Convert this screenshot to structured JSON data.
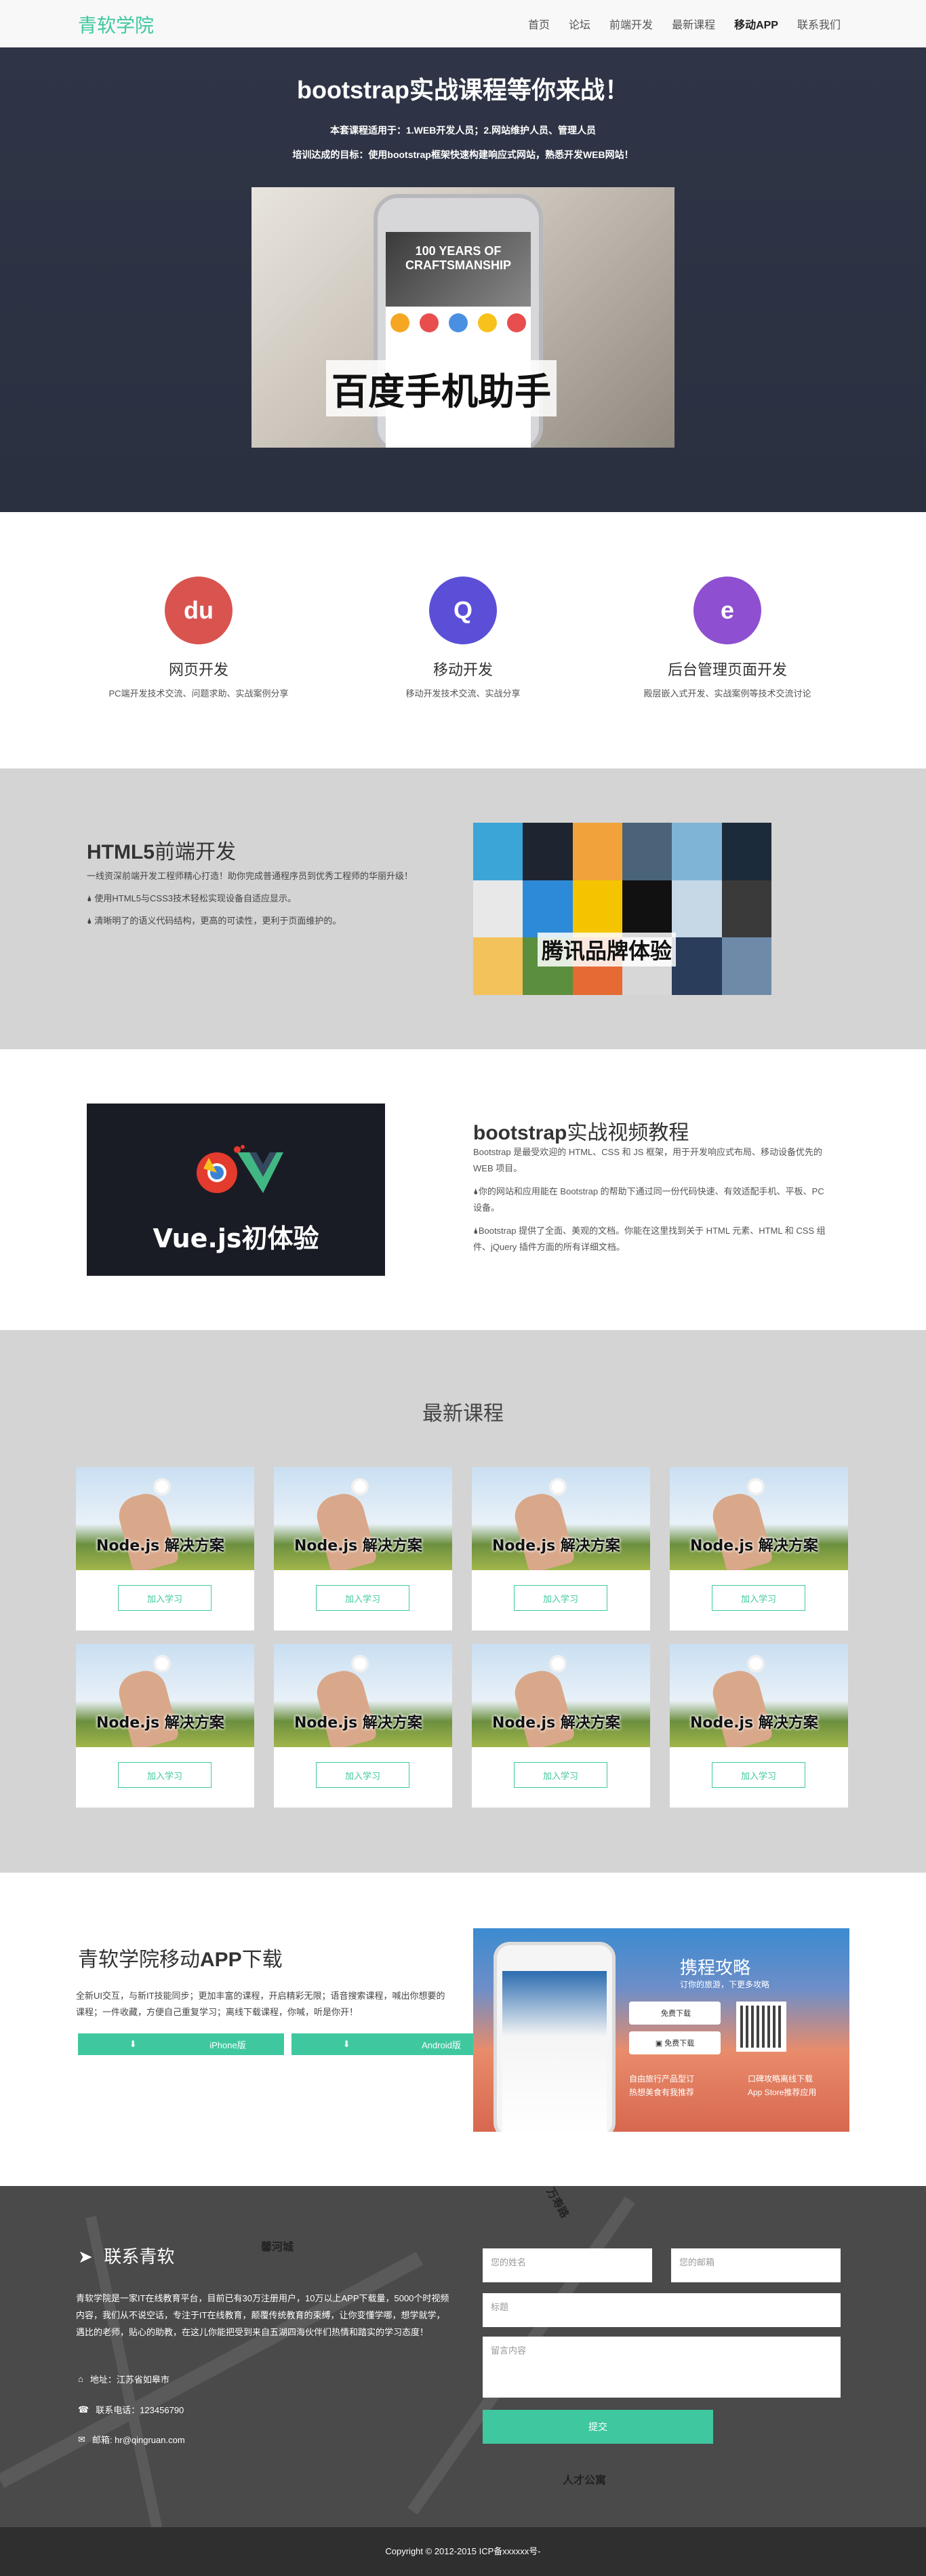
{
  "nav": {
    "brand": "青软学院",
    "items": [
      "首页",
      "论坛",
      "前端开发",
      "最新课程",
      "移动APP",
      "联系我们"
    ]
  },
  "hero": {
    "title": "bootstrap实战课程等你来战！",
    "sub1": "本套课程适用于：1.WEB开发人员；2.网站维护人员、管理人员",
    "sub2": "培训达成的目标：使用bootstrap框架快速构建响应式网站，熟悉开发WEB网站！",
    "image_caption": "百度手机助手",
    "phone_banner": "100 YEARS OF CRAFTSMANSHIP"
  },
  "features": [
    {
      "title": "网页开发",
      "desc": "PC端开发技术交流、问题求助、实战案例分享",
      "icon": "baidu-paw-icon",
      "color": "#d9534f",
      "glyph": "du"
    },
    {
      "title": "移动开发",
      "desc": "移动开发技术交流、实战分享",
      "icon": "qq-penguin-icon",
      "color": "#5b4fd8",
      "glyph": "Q"
    },
    {
      "title": "后台管理页面开发",
      "desc": "殿层嵌入式开发、实战案例等技术交流讨论",
      "icon": "alibaba-icon",
      "color": "#8e4fd0",
      "glyph": "e"
    }
  ],
  "html5": {
    "title_bold": "HTML5",
    "title_rest": "前端开发",
    "line1": "一线资深前端开发工程师精心打造！助你完成普通程序员到优秀工程师的华丽升级！",
    "line2": "使用HTML5与CSS3技术轻松实现设备自适应显示。",
    "line3": "清晰明了的语义代码结构，更高的可读性，更利于页面维护的。",
    "image_caption": "腾讯品牌体验"
  },
  "vue": {
    "image_caption": "Vue.js初体验",
    "title_bold": "bootstrap",
    "title_rest": "实战视频教程",
    "p1": "Bootstrap 是最受欢迎的 HTML、CSS 和 JS 框架，用于开发响应式布局、移动设备优先的 WEB 项目。",
    "p2": "你的网站和应用能在 Bootstrap 的帮助下通过同一份代码快速、有效适配手机、平板、PC 设备。",
    "p3": "Bootstrap 提供了全面、美观的文档。你能在这里找到关于 HTML 元素、HTML 和 CSS 组件、jQuery 插件方面的所有详细文档。"
  },
  "courses": {
    "title": "最新课程",
    "items": [
      {
        "caption": "Node.js 解决方案",
        "button": "加入学习"
      },
      {
        "caption": "Node.js 解决方案",
        "button": "加入学习"
      },
      {
        "caption": "Node.js 解决方案",
        "button": "加入学习"
      },
      {
        "caption": "Node.js 解决方案",
        "button": "加入学习"
      },
      {
        "caption": "Node.js 解决方案",
        "button": "加入学习"
      },
      {
        "caption": "Node.js 解决方案",
        "button": "加入学习"
      },
      {
        "caption": "Node.js 解决方案",
        "button": "加入学习"
      },
      {
        "caption": "Node.js 解决方案",
        "button": "加入学习"
      }
    ]
  },
  "app": {
    "title_a": "青软学院移动",
    "title_b": "APP",
    "title_c": "下载",
    "desc": "全新UI交互，与新IT技能同步；更加丰富的课程，开启精彩无限；语音搜索课程，喊出你想要的课程；一件收藏，方便自己重复学习；离线下载课程，你喊，听是你开！",
    "btn_iphone": "iPhone版",
    "btn_android": "Android版",
    "img_title": "携程攻略",
    "img_sub": "订你的旅游，下更多攻略",
    "store1": "免费下载",
    "store2": "免费下载",
    "foot1": "自由旅行产品型订",
    "foot2": "口碑攻略离线下载",
    "foot3": "热想美食有我推荐",
    "foot4": "App Store推荐应用"
  },
  "contact": {
    "title": "联系青软",
    "intro": "青软学院是一家IT在线教育平台，目前已有30万注册用户，10万以上APP下载量，5000个时视频内容，我们从不说空话，专注于IT在线教育，颠覆传统教育的束缚，让你变懂学哪，想学就学，遇比的老师，贴心的助教，在这儿你能把受到来自五湖四海伙伴们热情和踏实的学习态度！",
    "address": "地址：江苏省如皋市",
    "phone": "联系电话：123456790",
    "email": "邮箱: hr@qingruan.com",
    "ph_name": "您的姓名",
    "ph_email": "您的邮箱",
    "ph_title": "标题",
    "ph_msg": "留言内容",
    "submit": "提交",
    "map_labels": [
      "馨河城",
      "万寿路",
      "人才公寓"
    ]
  },
  "footer": {
    "text": "Copyright © 2012-2015    ICP备xxxxxx号-"
  }
}
